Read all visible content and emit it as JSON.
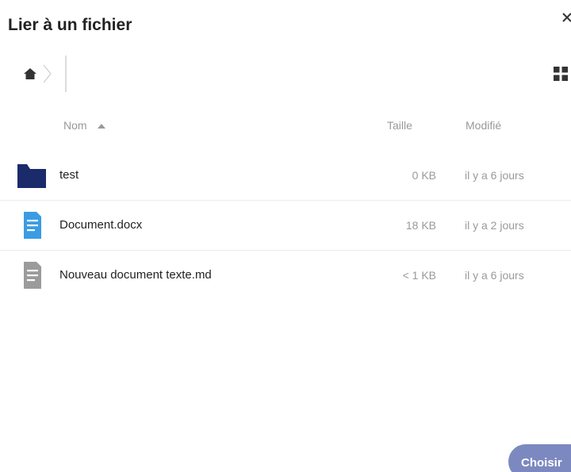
{
  "dialog": {
    "title": "Lier à un fichier"
  },
  "breadcrumb": {
    "home_icon": "home-icon"
  },
  "columns": {
    "name": "Nom",
    "size": "Taille",
    "modified": "Modifié",
    "sort_icon": "sort-ascending-icon"
  },
  "files": [
    {
      "name": "test",
      "size": "0 KB",
      "modified": "il y a 6 jours",
      "icon": "folder-icon",
      "color": "#1b2a6b"
    },
    {
      "name": "Document.docx",
      "size": "18 KB",
      "modified": "il y a 2 jours",
      "icon": "document-icon",
      "color": "#3b9ce3"
    },
    {
      "name": "Nouveau document texte.md",
      "size": "< 1 KB",
      "modified": "il y a 6 jours",
      "icon": "text-file-icon",
      "color": "#9b9b9b"
    }
  ],
  "actions": {
    "choose_label": "Choisir"
  },
  "colors": {
    "primary": "#7c89c0",
    "muted_text": "#999999"
  }
}
